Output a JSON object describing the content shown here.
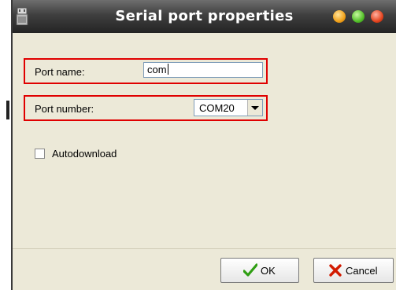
{
  "window": {
    "title": "Serial port properties"
  },
  "form": {
    "port_name": {
      "label": "Port name:",
      "value": "com"
    },
    "port_number": {
      "label": "Port number:",
      "selected": "COM20"
    },
    "autodownload": {
      "label": "Autodownload",
      "checked": false
    }
  },
  "buttons": {
    "ok_label": "OK",
    "cancel_label": "Cancel"
  },
  "icons": {
    "app": "serial-port-icon",
    "minimize": "minimize-icon",
    "maximize": "maximize-icon",
    "close": "close-icon",
    "ok": "check-icon",
    "cancel": "cross-icon"
  },
  "colors": {
    "highlight": "#e00000",
    "ok_check": "#2f9e13",
    "cancel_x": "#d21a00"
  }
}
